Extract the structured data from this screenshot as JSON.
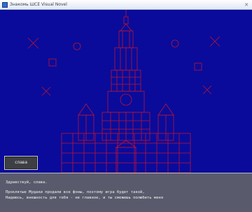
{
  "window": {
    "title": "Знакомь ШСЕ Visual Novel"
  },
  "speaker": {
    "name": "слава"
  },
  "dialog": {
    "lines": [
      "Здравствуй, слава.",
      "Проклятые Мудаки продали все фоны, поэтому игра будет такой,",
      "Надеюсь, внешность для тебя - не главное, и ты сможешь полюбить меня"
    ]
  },
  "scene": {
    "background_color": "#0a0b9a",
    "line_color": "#d0142a",
    "subject": "university-tower"
  }
}
